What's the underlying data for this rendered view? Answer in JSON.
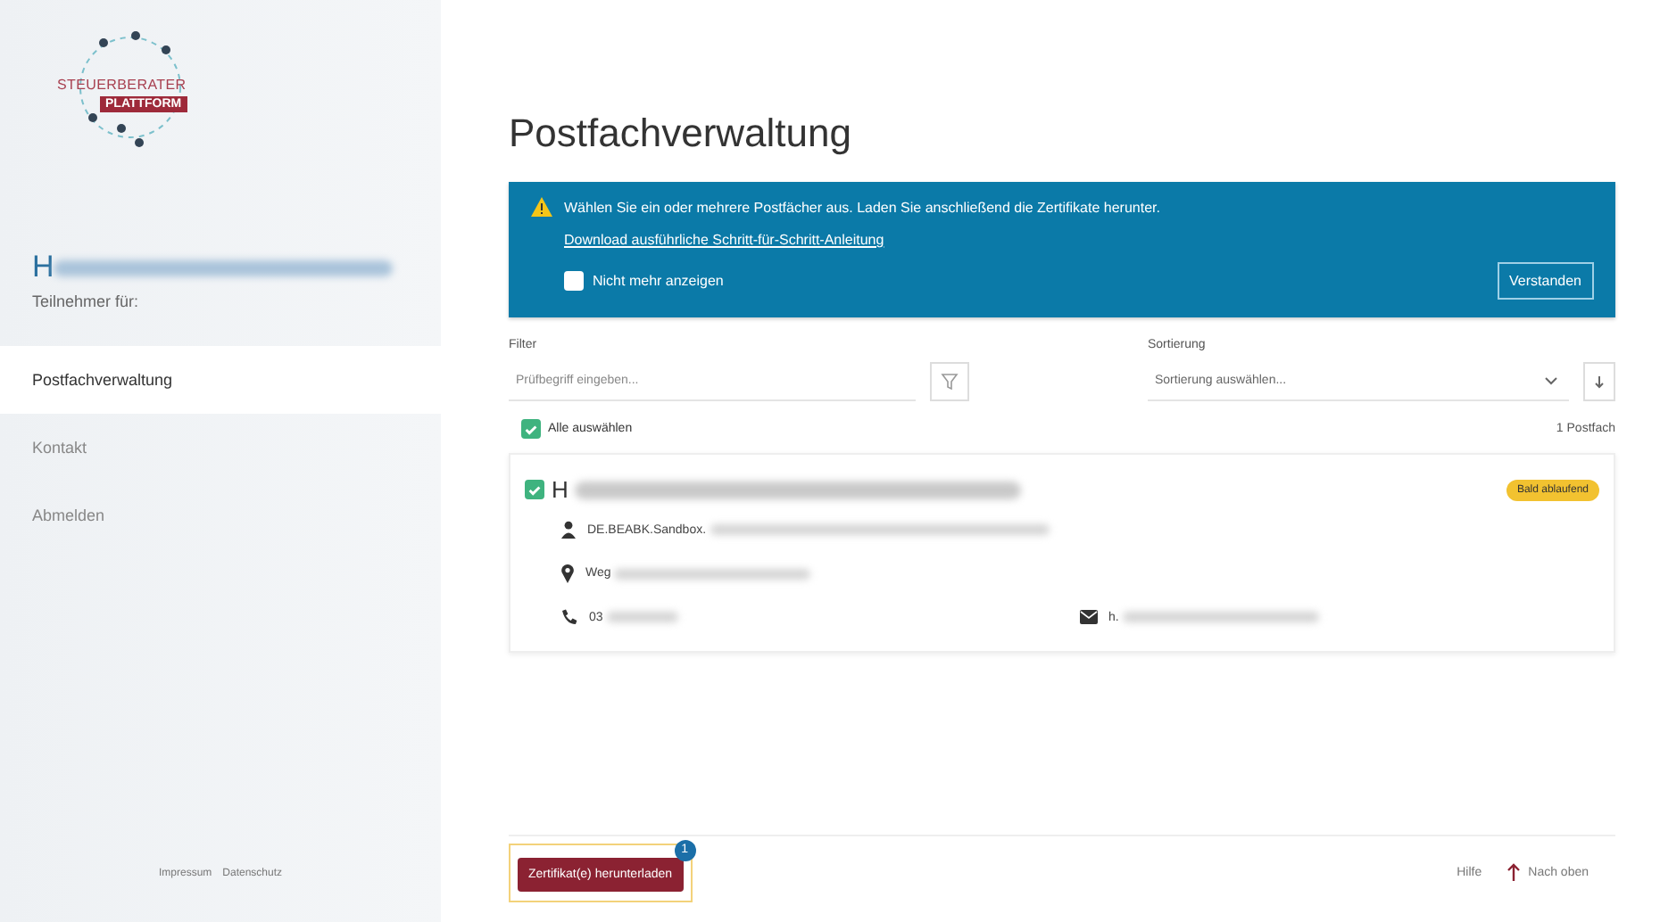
{
  "sidebar": {
    "logo": {
      "line1": "STEUERBERATER",
      "line2": "PLATTFORM"
    },
    "user": {
      "name_visible": "H",
      "redacted": true,
      "subtitle": "Teilnehmer für:"
    },
    "nav": [
      {
        "label": "Postfachverwaltung",
        "selected": true
      },
      {
        "label": "Kontakt",
        "selected": false
      },
      {
        "label": "Abmelden",
        "selected": false
      }
    ],
    "footer_links": [
      "Impressum",
      "Datenschutz"
    ]
  },
  "page_title": "Postfachverwaltung",
  "notice": {
    "text": "Wählen Sie ein oder mehrere Postfächer aus. Laden Sie anschließend die Zertifikate herunter.",
    "link": "Download ausführliche Schritt-für-Schritt-Anleitung",
    "checkbox": {
      "label": "Nicht mehr anzeigen",
      "checked": false
    },
    "button": "Verstanden"
  },
  "filter": {
    "label": "Filter",
    "placeholder": "Prüfbegriff eingeben..."
  },
  "sort": {
    "label": "Sortierung",
    "placeholder": "Sortierung auswählen..."
  },
  "select_all": {
    "label": "Alle auswählen",
    "checked": true
  },
  "count": "1 Postfach",
  "mailboxes": [
    {
      "name_visible": "H",
      "checked": true,
      "badge": "Bald ablaufend",
      "details": [
        {
          "kind": "person",
          "text": "DE.BEABK.Sandbox."
        },
        {
          "kind": "location",
          "text": "Weg"
        },
        {
          "kind": "phone",
          "text": "03"
        },
        {
          "kind": "mail",
          "text": "h."
        }
      ]
    }
  ],
  "download_button": {
    "label": "Zertifikat(e) herunterladen",
    "badge": "1"
  },
  "footer_links": [
    {
      "kind": "help",
      "label": "Hilfe"
    },
    {
      "kind": "top",
      "label": "Nach oben"
    }
  ]
}
